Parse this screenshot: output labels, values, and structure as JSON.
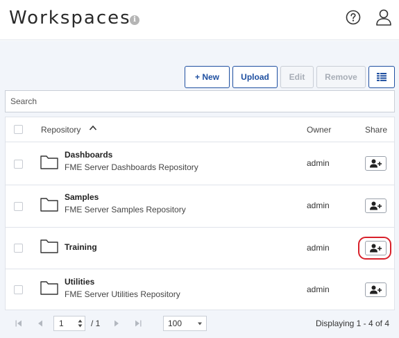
{
  "header": {
    "title": "Workspaces",
    "info_glyph": "i"
  },
  "toolbar": {
    "new_label": "+ New",
    "upload_label": "Upload",
    "edit_label": "Edit",
    "remove_label": "Remove",
    "columns_icon": "columns-icon"
  },
  "search": {
    "placeholder": "Search",
    "value": ""
  },
  "table": {
    "headers": {
      "repository": "Repository",
      "owner": "Owner",
      "share": "Share"
    },
    "sort": "ascending",
    "rows": [
      {
        "name": "Dashboards",
        "description": "FME Server Dashboards Repository",
        "owner": "admin"
      },
      {
        "name": "Samples",
        "description": "FME Server Samples Repository",
        "owner": "admin"
      },
      {
        "name": "Training",
        "description": "",
        "owner": "admin",
        "highlighted": true
      },
      {
        "name": "Utilities",
        "description": "FME Server Utilities Repository",
        "owner": "admin"
      }
    ]
  },
  "pager": {
    "page": "1",
    "page_count": "/ 1",
    "page_size": "100",
    "displaying": "Displaying 1 - 4 of 4"
  },
  "colors": {
    "accent": "#1e4fa0",
    "highlight": "#d8202a",
    "background": "#f2f5fa"
  }
}
